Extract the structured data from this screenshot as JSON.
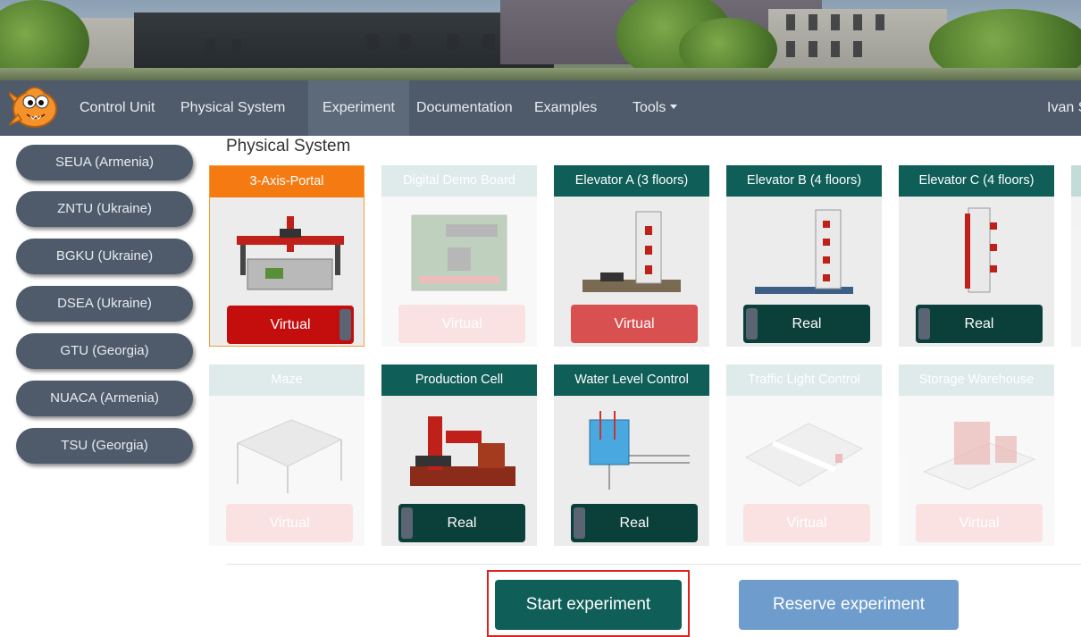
{
  "navbar": {
    "items": [
      {
        "label": "Control Unit"
      },
      {
        "label": "Physical System"
      },
      {
        "label": "Experiment"
      },
      {
        "label": "Documentation"
      },
      {
        "label": "Examples"
      },
      {
        "label": "Tools"
      }
    ],
    "active": "Experiment",
    "user": "Ivan S"
  },
  "sidebar": {
    "items": [
      {
        "label": "SEUA (Armenia)"
      },
      {
        "label": "ZNTU (Ukraine)"
      },
      {
        "label": "BGKU (Ukraine)"
      },
      {
        "label": "DSEA (Ukraine)"
      },
      {
        "label": "GTU (Georgia)"
      },
      {
        "label": "NUACA (Armenia)"
      },
      {
        "label": "TSU (Georgia)"
      }
    ]
  },
  "main": {
    "section_title": "Physical System",
    "systems": [
      {
        "name": "3-Axis-Portal",
        "mode": "Virtual",
        "state": "selected"
      },
      {
        "name": "Digital Demo Board",
        "mode": "Virtual",
        "state": "disabled"
      },
      {
        "name": "Elevator A (3 floors)",
        "mode": "Virtual",
        "state": "available"
      },
      {
        "name": "Elevator B (4 floors)",
        "mode": "Real",
        "state": "available"
      },
      {
        "name": "Elevator C (4 floors)",
        "mode": "Real",
        "state": "available"
      },
      {
        "name": "Maze",
        "mode": "Virtual",
        "state": "disabled"
      },
      {
        "name": "Production Cell",
        "mode": "Real",
        "state": "available"
      },
      {
        "name": "Water Level Control",
        "mode": "Real",
        "state": "available"
      },
      {
        "name": "Traffic Light Control",
        "mode": "Virtual",
        "state": "disabled"
      },
      {
        "name": "Storage Warehouse",
        "mode": "Virtual",
        "state": "disabled"
      }
    ]
  },
  "actions": {
    "start_label": "Start experiment",
    "reserve_label": "Reserve experiment"
  },
  "colors": {
    "nav_bg": "#4f5b6b",
    "card_header": "#0f5e58",
    "selected_header": "#f57a12",
    "virtual_toggle": "#c40d0d",
    "real_toggle": "#0a3f3a",
    "reserve_button": "#6e9ccc",
    "highlight": "#e02020"
  }
}
